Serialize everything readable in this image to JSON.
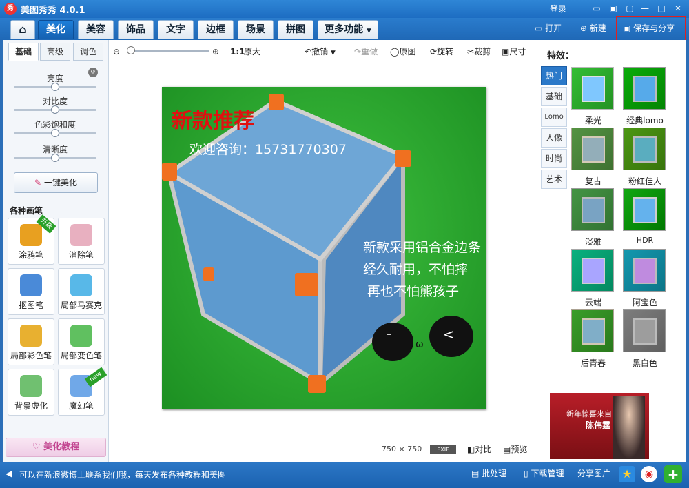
{
  "app": {
    "title": "美图秀秀 4.0.1",
    "logo_text": "秀",
    "login": "登录"
  },
  "nav": {
    "tabs": [
      "美化",
      "美容",
      "饰品",
      "文字",
      "边框",
      "场景",
      "拼图"
    ],
    "more": "更多功能",
    "open": "打开",
    "new": "新建",
    "save_share": "保存与分享"
  },
  "left": {
    "subtabs": [
      "基础",
      "高级",
      "调色"
    ],
    "sliders": [
      {
        "label": "亮度",
        "value": 0.5
      },
      {
        "label": "对比度",
        "value": 0.5
      },
      {
        "label": "色彩饱和度",
        "value": 0.5
      },
      {
        "label": "清晰度",
        "value": 0.5
      }
    ],
    "onekey": "一键美化",
    "brushes_title": "各种画笔",
    "brushes": [
      {
        "label": "涂鸦笔",
        "badge": "升级",
        "color": "#e8a020"
      },
      {
        "label": "消除笔",
        "badge": "",
        "color": "#e8b0c0"
      },
      {
        "label": "抠图笔",
        "badge": "",
        "color": "#4a8ad8"
      },
      {
        "label": "局部马赛克",
        "badge": "",
        "color": "#58b8e8"
      },
      {
        "label": "局部彩色笔",
        "badge": "",
        "color": "#e8b030"
      },
      {
        "label": "局部变色笔",
        "badge": "",
        "color": "#60c060"
      },
      {
        "label": "背景虚化",
        "badge": "",
        "color": "#70c070"
      },
      {
        "label": "魔幻笔",
        "badge": "new",
        "color": "#70a8e8"
      }
    ],
    "tutorial": "美化教程"
  },
  "toolbar": {
    "zoom_ratio": "1:1",
    "original_size": "原大",
    "undo": "撤销",
    "redo": "重做",
    "original": "原图",
    "rotate": "旋转",
    "crop": "裁剪",
    "resize": "尺寸"
  },
  "photo": {
    "headline": "新款推荐",
    "contact": "欢迎咨询：15731770307",
    "line1": "新款采用铝合金边条",
    "line2": "经久耐用，不怕摔",
    "line3": "再也不怕熊孩子"
  },
  "footer": {
    "width": "750",
    "x": "×",
    "height": "750",
    "exif": "EXIF",
    "compare": "对比",
    "preview": "预览"
  },
  "effects": {
    "title": "特效：",
    "tabs": [
      "热门",
      "基础",
      "Lomo",
      "人像",
      "时尚",
      "艺术"
    ],
    "items": [
      "柔光",
      "经典lomo",
      "复古",
      "粉红佳人",
      "淡雅",
      "HDR",
      "云端",
      "阿宝色",
      "后青春",
      "黑白色"
    ],
    "ad_text": "新年惊喜来自",
    "ad_name": "陈伟霆"
  },
  "status": {
    "text": "可以在新浪微博上联系我们哦，每天发布各种教程和美图",
    "batch": "批处理",
    "download": "下载管理",
    "share": "分享图片"
  },
  "colors": {
    "accent": "#1d6dc2",
    "highlight": "#e02020"
  }
}
